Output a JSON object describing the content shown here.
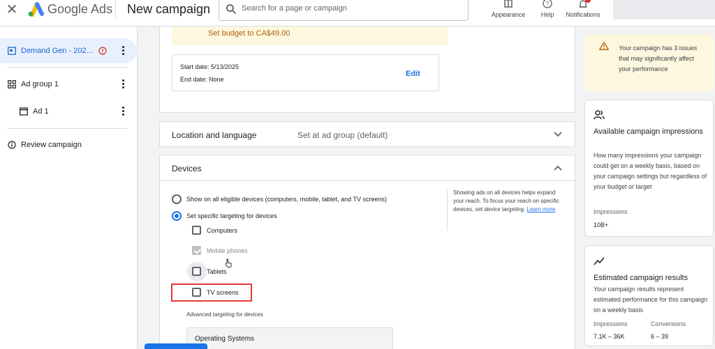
{
  "topbar": {
    "brand": "Google Ads",
    "page_title": "New campaign",
    "search_placeholder": "Search for a page or campaign",
    "appearance_label": "Appearance",
    "help_label": "Help",
    "notifications_label": "Notifications"
  },
  "sidebar": {
    "campaign_label": "Demand Gen - 202...",
    "ad_group_label": "Ad group 1",
    "ad_label": "Ad 1",
    "review_label": "Review campaign"
  },
  "budget": {
    "banner_text": "Set budget to CA$49.00",
    "start_date": "Start date: 5/13/2025",
    "end_date": "End date: None",
    "edit_label": "Edit"
  },
  "location": {
    "title": "Location and language",
    "value": "Set at ad group (default)"
  },
  "devices": {
    "title": "Devices",
    "option_all": "Show on all eligible devices (computers, mobile, tablet, and TV screens)",
    "option_specific": "Set specific targeting for devices",
    "computers": "Computers",
    "mobile": "Mobile phones",
    "tablets": "Tablets",
    "tv": "TV screens",
    "advanced_label": "Advanced targeting for devices",
    "os_label": "Operating Systems",
    "help_text": "Showing ads on all devices helps expand your reach. To focus your reach on specific devices, set device targeting.",
    "learn_more": "Learn more"
  },
  "right_panel": {
    "warning": "Your campaign has 3 issues that may significantly affect your performance",
    "impressions_title": "Available campaign impressions",
    "impressions_desc": "How many impressions your campaign could get on a weekly basis, based on your campaign settings but regardless of your budget or target",
    "impressions_key": "Impressions",
    "impressions_value": "10B+",
    "results_title": "Estimated campaign results",
    "results_desc": "Your campaign results represent estimated performance for this campaign on a weekly basis",
    "results_impressions_key": "Impressions",
    "results_impressions_value": "7.1K – 36K",
    "results_conversions_key": "Conversions",
    "results_conversions_value": "6 – 39"
  },
  "colors": {
    "accent": "#1a73e8",
    "warning_bg": "#fef7e0",
    "error": "#d93025",
    "highlight_outline": "#e53935"
  }
}
